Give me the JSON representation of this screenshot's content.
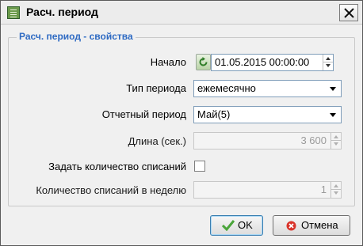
{
  "window": {
    "title": "Расч. период",
    "icon": "table-icon",
    "close_icon": "close-icon"
  },
  "group": {
    "legend": "Расч. период - свойства"
  },
  "fields": {
    "start": {
      "label": "Начало",
      "value": "01.05.2015 00:00:00",
      "reset_icon": "refresh-icon"
    },
    "period_type": {
      "label": "Тип периода",
      "value": "ежемесячно"
    },
    "report_period": {
      "label": "Отчетный период",
      "value": "Май(5)"
    },
    "length": {
      "label": "Длина (сек.)",
      "value": "3 600"
    },
    "set_count": {
      "label": "Задать количество списаний",
      "checked": false
    },
    "count_per_week": {
      "label": "Количество списаний в неделю",
      "value": "1"
    }
  },
  "buttons": {
    "ok": {
      "label": "OK",
      "icon": "checkmark-icon",
      "color": "#4aa53a"
    },
    "cancel": {
      "label": "Отмена",
      "icon": "cancel-icon",
      "color": "#d9342b"
    }
  },
  "colors": {
    "legend": "#2f6bc3",
    "field_border": "#7f9db9"
  }
}
